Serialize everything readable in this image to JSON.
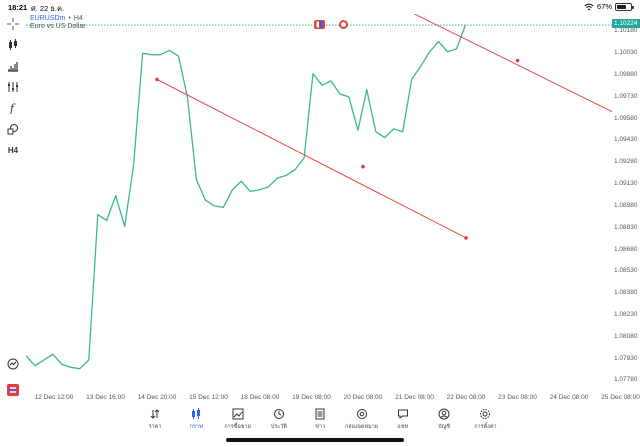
{
  "status_bar": {
    "time": "18:21",
    "date": "ศ. 22 ธ.ค.",
    "battery": "67%",
    "battery_level": 0.67
  },
  "symbol": {
    "ticker": "EURUSDm",
    "separator": "•",
    "timeframe": "H4",
    "description": "Euro vs US Dollar"
  },
  "trade_buttons": {
    "sell_icon": "sell-icon",
    "buy_icon": "buy-icon"
  },
  "toolbar": {
    "timeframe": "H4"
  },
  "price_axis": {
    "current_price": "1.10224",
    "ticks": [
      "1.10180",
      "1.10030",
      "1.09880",
      "1.09730",
      "1.09580",
      "1.09430",
      "1.09280",
      "1.09130",
      "1.08980",
      "1.08830",
      "1.08680",
      "1.08530",
      "1.08380",
      "1.08230",
      "1.08080",
      "1.07930",
      "1.07780"
    ]
  },
  "time_axis": {
    "ticks": [
      "12 Dec 12:00",
      "13 Dec 16:00",
      "14 Dec 20:00",
      "15 Dec 12:00",
      "18 Dec 08:00",
      "19 Dec 08:00",
      "20 Dec 08:00",
      "21 Dec 08:00",
      "22 Dec 08:00",
      "23 Dec 08:00",
      "24 Dec 08:00",
      "25 Dec 08:00"
    ]
  },
  "chart_data": {
    "type": "line",
    "series": [
      {
        "values": [
          1.0795,
          1.0788,
          1.0792,
          1.0796,
          1.0789,
          1.0787,
          1.0786,
          1.0792,
          1.0892,
          1.0888,
          1.0905,
          1.0884,
          1.0926,
          1.1003,
          1.1002,
          1.1002,
          1.1005,
          1.1001,
          1.0973,
          1.0916,
          1.0902,
          1.0898,
          1.0897,
          1.0909,
          1.0915,
          1.0908,
          1.0909,
          1.0911,
          1.0917,
          1.0919,
          1.0923,
          1.0931,
          1.0989,
          1.0981,
          1.0984,
          1.0975,
          1.0973,
          1.095,
          1.0978,
          1.0949,
          1.0945,
          1.0951,
          1.0949,
          1.0985,
          1.0994,
          1.1004,
          1.1011,
          1.1004,
          1.1006,
          1.10224
        ]
      }
    ],
    "trendlines": [
      {
        "color": "#e53935",
        "points": [
          {
            "x": "14 Dec 20:00",
            "y": 1.0985
          },
          {
            "x": "20 Dec 08:00",
            "y": 1.0925
          },
          {
            "x": "22 Dec 08:00",
            "y": 1.0876
          }
        ]
      },
      {
        "color": "#e53935",
        "points": [
          {
            "x": "21 Dec 08:00",
            "y": 1.103
          },
          {
            "x": "23 Dec 08:00",
            "y": 1.0998
          },
          {
            "x": "25 Dec 08:00",
            "y": 1.096
          }
        ]
      }
    ],
    "ylim": [
      1.077,
      1.103
    ],
    "line_color": "#3cb88e",
    "current_price_line_color": "#26a69a",
    "grid": false
  },
  "bottom_nav": {
    "items": [
      {
        "label": "ราคา",
        "icon": "quotes-icon"
      },
      {
        "label": "กราฟ",
        "icon": "chart-candles-icon",
        "active": true
      },
      {
        "label": "การซื้อขาย",
        "icon": "trade-icon"
      },
      {
        "label": "ประวัติ",
        "icon": "history-icon"
      },
      {
        "label": "ข่าว",
        "icon": "news-icon"
      },
      {
        "label": "กล่องจดหมาย",
        "icon": "mailbox-icon"
      },
      {
        "label": "แชท",
        "icon": "chat-icon"
      },
      {
        "label": "บัญชี",
        "icon": "account-icon"
      },
      {
        "label": "การตั้งค่า",
        "icon": "settings-icon"
      }
    ]
  }
}
